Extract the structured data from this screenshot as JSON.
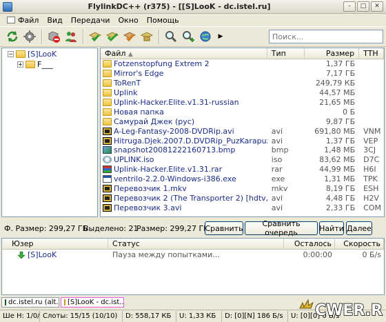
{
  "window": {
    "title": "FlylinkDC++ (r375) - [[S]LooK - dc.istel.ru]"
  },
  "menu": [
    "Файл",
    "Вид",
    "Передачи",
    "Окно",
    "Помощь"
  ],
  "search": {
    "placeholder": "Поиск..."
  },
  "tree": {
    "root": "[S]LooK",
    "child": "F___"
  },
  "files": {
    "columns": {
      "name": "Файл",
      "type": "Тип",
      "size": "Размер",
      "tth": "TTH"
    },
    "rows": [
      {
        "icon": "folder",
        "name": "Fotzenstopfung Extrem 2",
        "type": "",
        "size": "1,37 ГБ",
        "tth": ""
      },
      {
        "icon": "folder",
        "name": "Mirror's Edge",
        "type": "",
        "size": "7,17 ГБ",
        "tth": ""
      },
      {
        "icon": "folder",
        "name": "ToRenT",
        "type": "",
        "size": "249,79 КБ",
        "tth": ""
      },
      {
        "icon": "folder",
        "name": "Uplink",
        "type": "",
        "size": "44,57 МБ",
        "tth": ""
      },
      {
        "icon": "folder",
        "name": "Uplink-Hacker.Elite.v1.31-russian",
        "type": "",
        "size": "21,65 МБ",
        "tth": ""
      },
      {
        "icon": "folder",
        "name": "Новая папка",
        "type": "",
        "size": "0 Б",
        "tth": ""
      },
      {
        "icon": "folder",
        "name": "Самурай Джек (рус)",
        "type": "",
        "size": "9,87 ГБ",
        "tth": ""
      },
      {
        "icon": "video",
        "name": "A-Leg-Fantasy-2008-DVDRip.avi",
        "type": "avi",
        "size": "691,80 МБ",
        "tth": "VNM"
      },
      {
        "icon": "video",
        "name": "Hitruga.Djek.2007.D.DVDRip_PuzKarapuz.avi",
        "type": "avi",
        "size": "1,37 ГБ",
        "tth": "VEP"
      },
      {
        "icon": "image",
        "name": "snapshot20081222160713.bmp",
        "type": "bmp",
        "size": "1,48 МБ",
        "tth": "3CJ"
      },
      {
        "icon": "iso",
        "name": "UPLINK.iso",
        "type": "iso",
        "size": "83,62 МБ",
        "tth": "D7C"
      },
      {
        "icon": "rar",
        "name": "Uplink-Hacker.Elite.v1.31.rar",
        "type": "rar",
        "size": "44,99 МБ",
        "tth": "H6I"
      },
      {
        "icon": "exe",
        "name": "ventrilo-2.2.0-Windows-i386.exe",
        "type": "exe",
        "size": "1,31 МБ",
        "tth": "TPK"
      },
      {
        "icon": "video",
        "name": "Перевозчик 1.mkv",
        "type": "mkv",
        "size": "8,19 ГБ",
        "tth": "ESH"
      },
      {
        "icon": "video",
        "name": "Перевозчик 2 (The Transporter 2) [hdtv,rus,eng].avi",
        "type": "avi",
        "size": "4,48 ГБ",
        "tth": "H2V"
      },
      {
        "icon": "video",
        "name": "Перевозчик 3.avi",
        "type": "avi",
        "size": "2,33 ГБ",
        "tth": "COM"
      }
    ]
  },
  "summary": {
    "total": "Ф. Размер: 299,27 ГБ",
    "selected": "Выделено: 21",
    "size": "Размер: 299,27 ГБ"
  },
  "buttons": {
    "compare": "Сравнить",
    "compare_queue": "Сравнить очередь",
    "find": "Найти",
    "next": "Далее"
  },
  "transfers": {
    "columns": {
      "user": "Юзер",
      "status": "Статус",
      "left": "Осталось",
      "speed": "Скорость"
    },
    "row": {
      "user": "[S]LooK",
      "status": "Пауза между попытками...",
      "left": "0:00:00",
      "speed": "0 Б/s"
    }
  },
  "hub_tabs": [
    "dc.istel.ru (alt...",
    "[S]LooK - dc.ist..."
  ],
  "statusbar": [
    "Ше Н: 1/0/0",
    "Слоты: 15/15 (10/10)",
    "D: 558,17 КБ",
    "U: 1,33 КБ",
    "D: [0][N] 186 Б/s",
    "U: [0][0] 0 Б/s"
  ],
  "watermark": "CWER.RU",
  "colors": {
    "accent": "#0054e3",
    "link": "#1a2c8a",
    "folder": "#eec23f"
  }
}
